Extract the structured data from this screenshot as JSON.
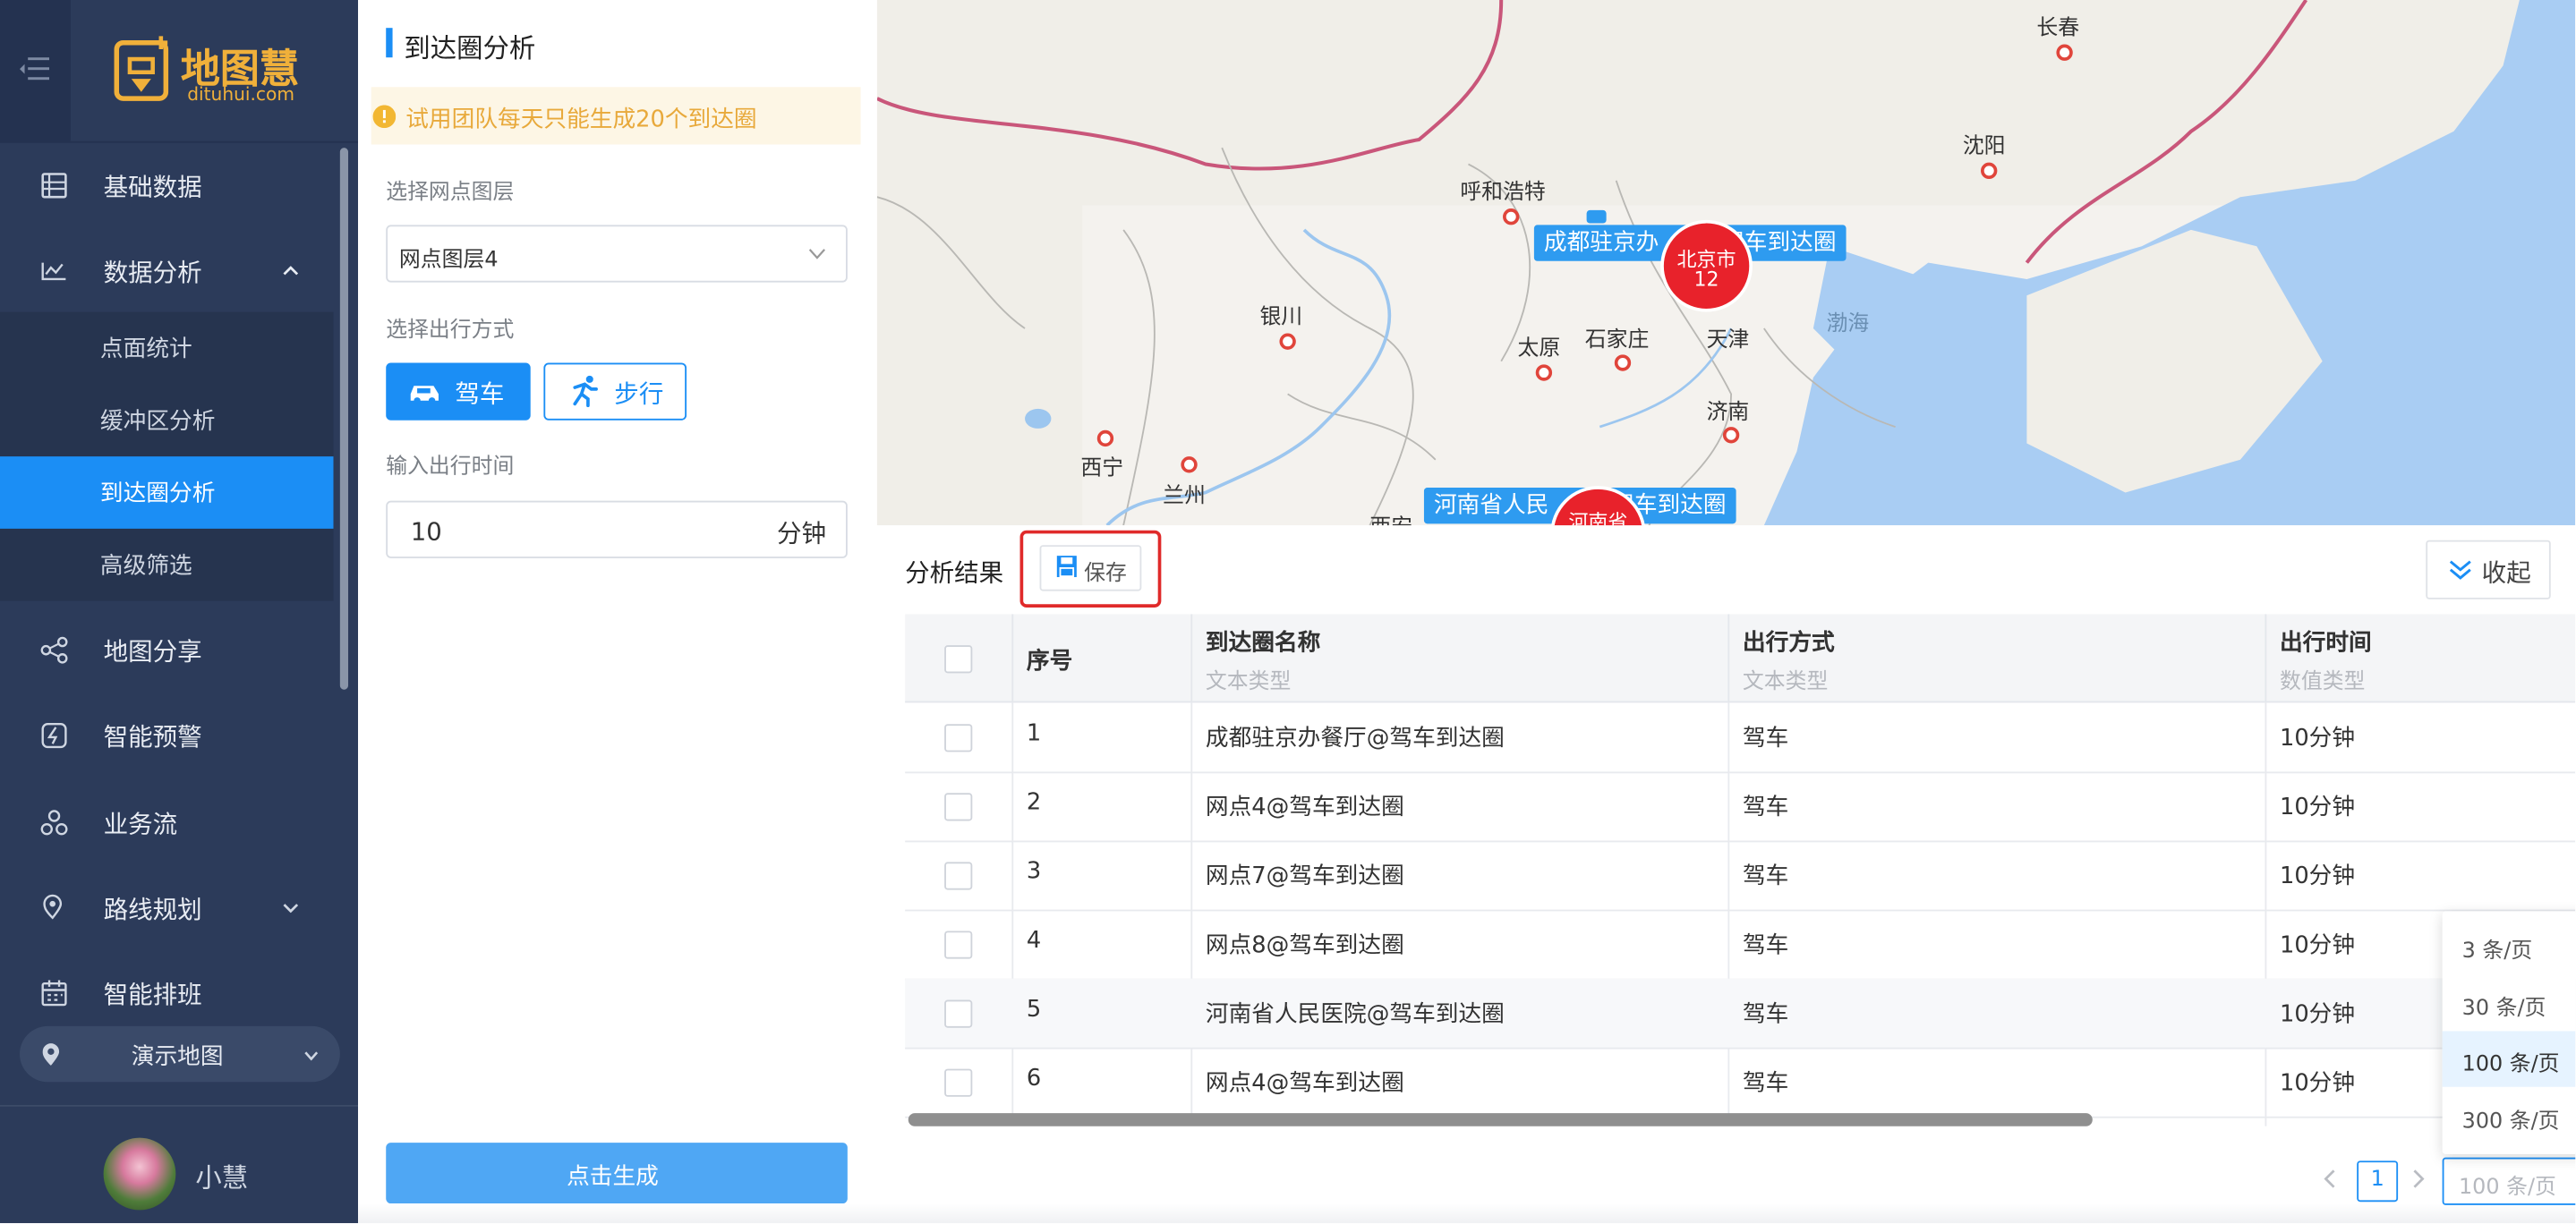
{
  "brand": {
    "logo_text": "地图慧",
    "logo_url": "dituhui.com"
  },
  "sidebar": {
    "items": [
      {
        "label": "基础数据",
        "icon": "database-icon"
      },
      {
        "label": "数据分析",
        "icon": "analysis-icon",
        "expanded": true
      },
      {
        "label": "地图分享",
        "icon": "share-icon"
      },
      {
        "label": "智能预警",
        "icon": "alert-icon"
      },
      {
        "label": "业务流",
        "icon": "workflow-icon"
      },
      {
        "label": "路线规划",
        "icon": "route-icon"
      },
      {
        "label": "智能排班",
        "icon": "calendar-icon"
      }
    ],
    "sub_items": [
      {
        "label": "点面统计"
      },
      {
        "label": "缓冲区分析"
      },
      {
        "label": "到达圈分析",
        "active": true
      },
      {
        "label": "高级筛选"
      }
    ],
    "demo_map": "演示地图",
    "user_name": "小慧"
  },
  "panel": {
    "title": "到达圈分析",
    "warning": "试用团队每天只能生成20个到达圈",
    "layer_label": "选择网点图层",
    "layer_value": "网点图层4",
    "mode_label": "选择出行方式",
    "mode_drive": "驾车",
    "mode_walk": "步行",
    "time_label": "输入出行时间",
    "time_value": "10",
    "time_unit": "分钟",
    "generate_button": "点击生成"
  },
  "map": {
    "cities": [
      "长春",
      "沈阳",
      "呼和浩特",
      "银川",
      "太原",
      "石家庄",
      "天津",
      "济南",
      "西宁",
      "兰州",
      "西安"
    ],
    "sea_label": "渤海",
    "cluster_beijing": {
      "name": "北京市",
      "count": "12"
    },
    "cluster_henan": {
      "name": "河南省"
    },
    "label_chengdu": "成都驻京办",
    "label_chengdu_tail": "驾车到达圈",
    "label_henan": "河南省人民",
    "label_henan_tail": "驾车到达圈"
  },
  "results": {
    "title": "分析结果",
    "save_button": "保存",
    "collapse_button": "收起",
    "columns": [
      {
        "name": "序号",
        "type": ""
      },
      {
        "name": "到达圈名称",
        "type": "文本类型"
      },
      {
        "name": "出行方式",
        "type": "文本类型"
      },
      {
        "name": "出行时间",
        "type": "数值类型"
      }
    ],
    "rows": [
      {
        "index": "1",
        "name": "成都驻京办餐厅@驾车到达圈",
        "mode": "驾车",
        "time": "10分钟"
      },
      {
        "index": "2",
        "name": "网点4@驾车到达圈",
        "mode": "驾车",
        "time": "10分钟"
      },
      {
        "index": "3",
        "name": "网点7@驾车到达圈",
        "mode": "驾车",
        "time": "10分钟"
      },
      {
        "index": "4",
        "name": "网点8@驾车到达圈",
        "mode": "驾车",
        "time": "10分钟"
      },
      {
        "index": "5",
        "name": "河南省人民医院@驾车到达圈",
        "mode": "驾车",
        "time": "10分钟"
      },
      {
        "index": "6",
        "name": "网点4@驾车到达圈",
        "mode": "驾车",
        "time": "10分钟"
      }
    ]
  },
  "pagination": {
    "page_size_options": [
      "3 条/页",
      "30 条/页",
      "100 条/页",
      "300 条/页"
    ],
    "selected_page_size": "100 条/页",
    "current_page": "1",
    "page_size_input": "100 条/页"
  },
  "colors": {
    "sidebar_bg": "#2c3b5a",
    "accent": "#1b8ef5",
    "highlight_border": "#e02a2a",
    "cluster_red": "#e8222b"
  }
}
